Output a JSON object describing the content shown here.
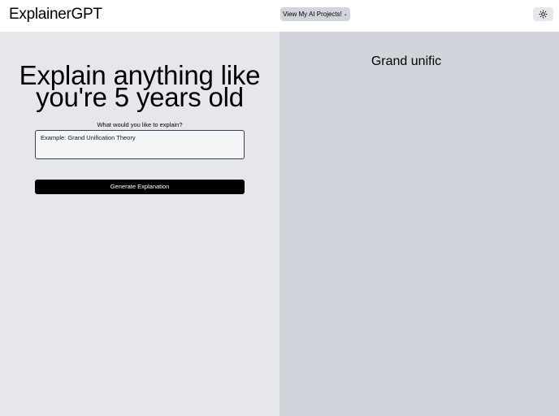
{
  "header": {
    "logo": "ExplainerGPT",
    "projects_button": "View My AI Projects!",
    "projects_chevron": "⌄",
    "theme_icon": "sun-icon"
  },
  "main": {
    "hero_line1": "Explain anything like",
    "hero_line2": "you're 5 years old",
    "prompt_label": "What would you like to explain?",
    "input_placeholder": "Example: Grand Unification Theory",
    "input_value": "",
    "generate_button": "Generate Explanation"
  },
  "result": {
    "title": "Grand unific"
  },
  "colors": {
    "left_pane_bg": "#e5e7eb",
    "right_pane_bg": "#d1d5db",
    "button_bg": "#000000",
    "chip_bg": "#d1d5db"
  }
}
